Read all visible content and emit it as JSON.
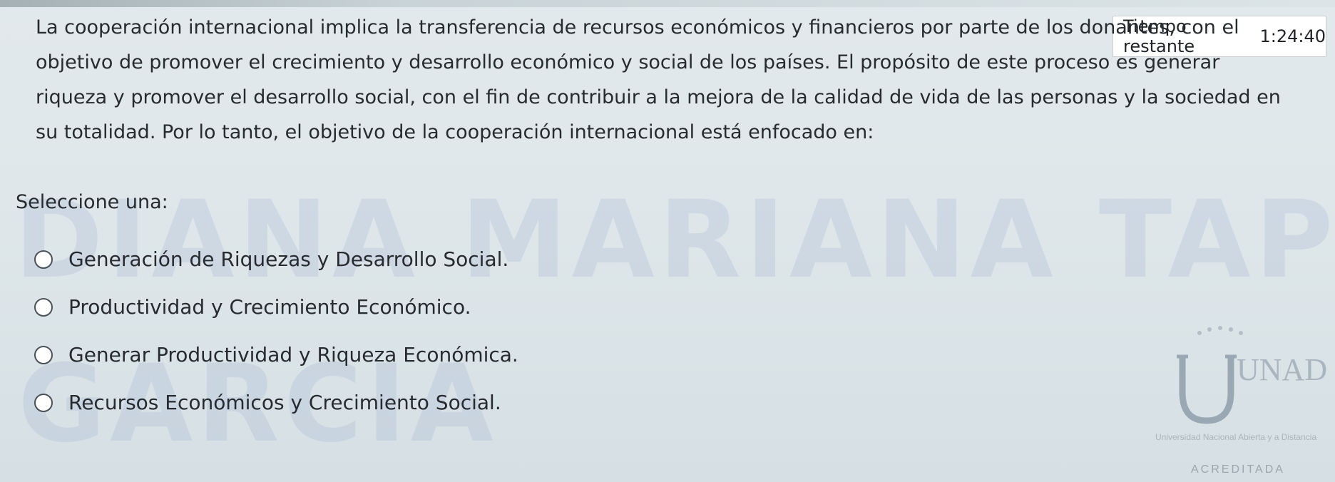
{
  "timer": {
    "label": "Tiempo restante",
    "value": "1:24:40"
  },
  "question": {
    "lines": [
      "La cooperación internacional implica la transferencia de recursos económicos y financieros por parte de los donantes, con el",
      "objetivo de promover el crecimiento y desarrollo económico y social de los países. El propósito de este proceso es generar",
      "riqueza y promover el desarrollo social, con el fin de contribuir a la mejora de la calidad de vida de las personas y la sociedad en",
      "su totalidad. Por lo tanto, el objetivo de la cooperación internacional está enfocado en:"
    ]
  },
  "prompt": "Seleccione una:",
  "options": [
    "Generación de Riquezas y Desarrollo Social.",
    "Productividad y Crecimiento Económico.",
    "Generar Productividad y Riqueza Económica.",
    "Recursos Económicos y Crecimiento Social."
  ],
  "watermark": {
    "line1": "DIANA MARIANA TAPIAS",
    "line2": "GARCIA"
  },
  "logo": {
    "text": "UNAD",
    "subtitle": "Universidad Nacional Abierta y a Distancia",
    "badge": "ACREDITADA"
  },
  "colors": {
    "background": "#dfe7ea",
    "text": "#272b2f",
    "timer_bg": "#ffffff",
    "watermark": "#4664b4",
    "logo": "#9aa8b4"
  }
}
